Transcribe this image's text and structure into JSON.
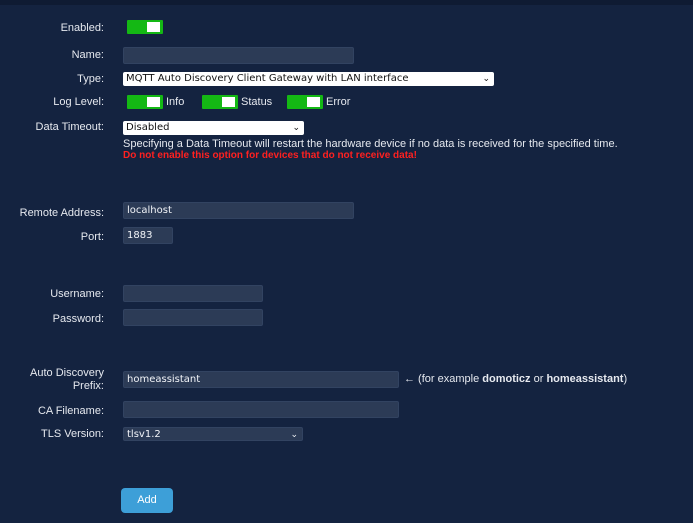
{
  "labels": {
    "enabled": "Enabled:",
    "name": "Name:",
    "type": "Type:",
    "log_level": "Log Level:",
    "data_timeout": "Data Timeout:",
    "remote_address": "Remote Address:",
    "port": "Port:",
    "username": "Username:",
    "password": "Password:",
    "auto_discovery_line1": "Auto Discovery",
    "auto_discovery_line2": "Prefix:",
    "ca_filename": "CA Filename:",
    "tls_version": "TLS Version:"
  },
  "fields": {
    "enabled": true,
    "name": "",
    "type": "MQTT Auto Discovery Client Gateway with LAN interface",
    "log_level": [
      {
        "label": "Info",
        "on": true
      },
      {
        "label": "Status",
        "on": true
      },
      {
        "label": "Error",
        "on": true
      }
    ],
    "data_timeout": "Disabled",
    "data_timeout_help": "Specifying a Data Timeout will restart the hardware device if no data is received for the specified time.",
    "data_timeout_warning": "Do not enable this option for devices that do not receive data!",
    "remote_address": "localhost",
    "port": "1883",
    "username": "",
    "password": "",
    "auto_discovery_prefix": "homeassistant",
    "auto_discovery_note_prefix": "← (for example ",
    "auto_discovery_note_ex1": "domoticz",
    "auto_discovery_note_or": " or ",
    "auto_discovery_note_ex2": "homeassistant",
    "auto_discovery_note_suffix": ")",
    "ca_filename": "",
    "tls_version": "tlsv1.2"
  },
  "buttons": {
    "add": "Add"
  },
  "icons": {
    "select_chevron": "chevron-down-icon"
  },
  "colors": {
    "background": "#142340",
    "toggle_on": "#14b814",
    "warning": "#ff2020",
    "button": "#3d9fd8"
  }
}
